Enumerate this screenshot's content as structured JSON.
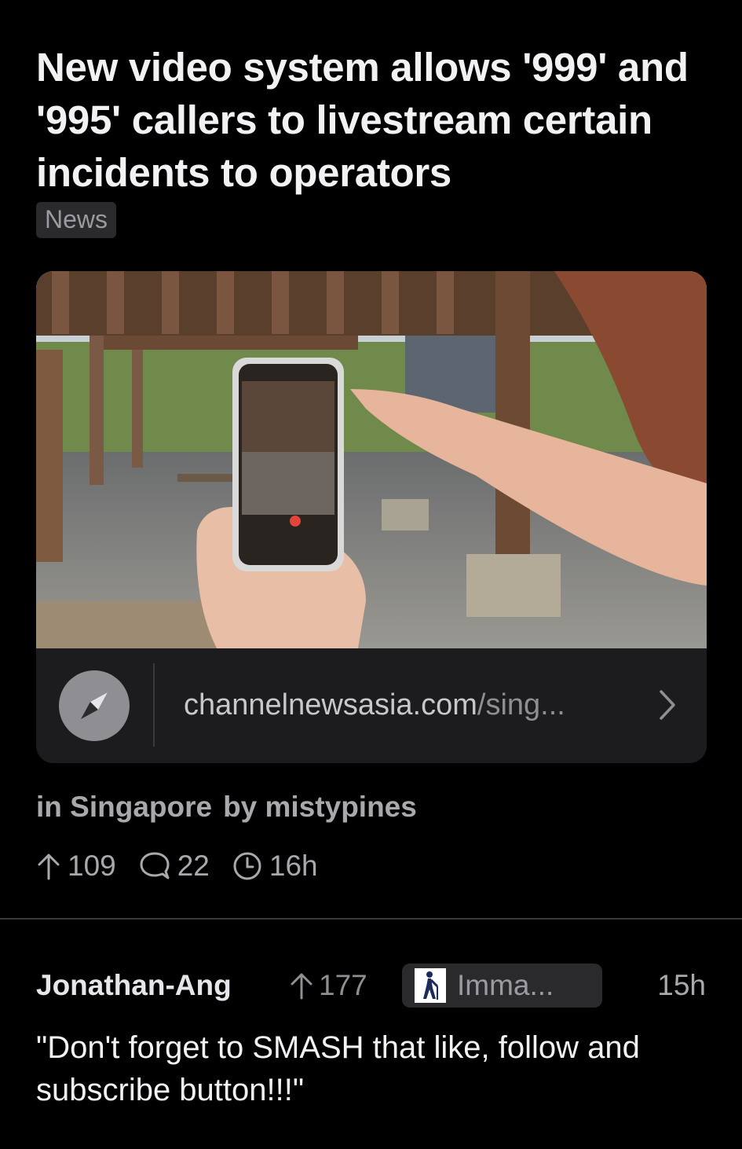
{
  "post": {
    "title": "New video system allows '999' and '995' callers to livestream certain incidents to operators",
    "flair": "News",
    "link": {
      "domain": "channelnewsasia.com",
      "path": "/sing...",
      "icon": "compass-icon"
    },
    "community": "in Singapore",
    "author": "by mistypines",
    "stats": {
      "upvotes": "109",
      "comments": "22",
      "age": "16h"
    }
  },
  "comment": {
    "author": "Jonathan-Ang",
    "score": "177",
    "flair_text": "Imma...",
    "flair_icon": "person-walking-cane-icon",
    "time": "15h",
    "body": "\"Don't forget to SMASH that like, follow and subscribe button!!!\""
  }
}
